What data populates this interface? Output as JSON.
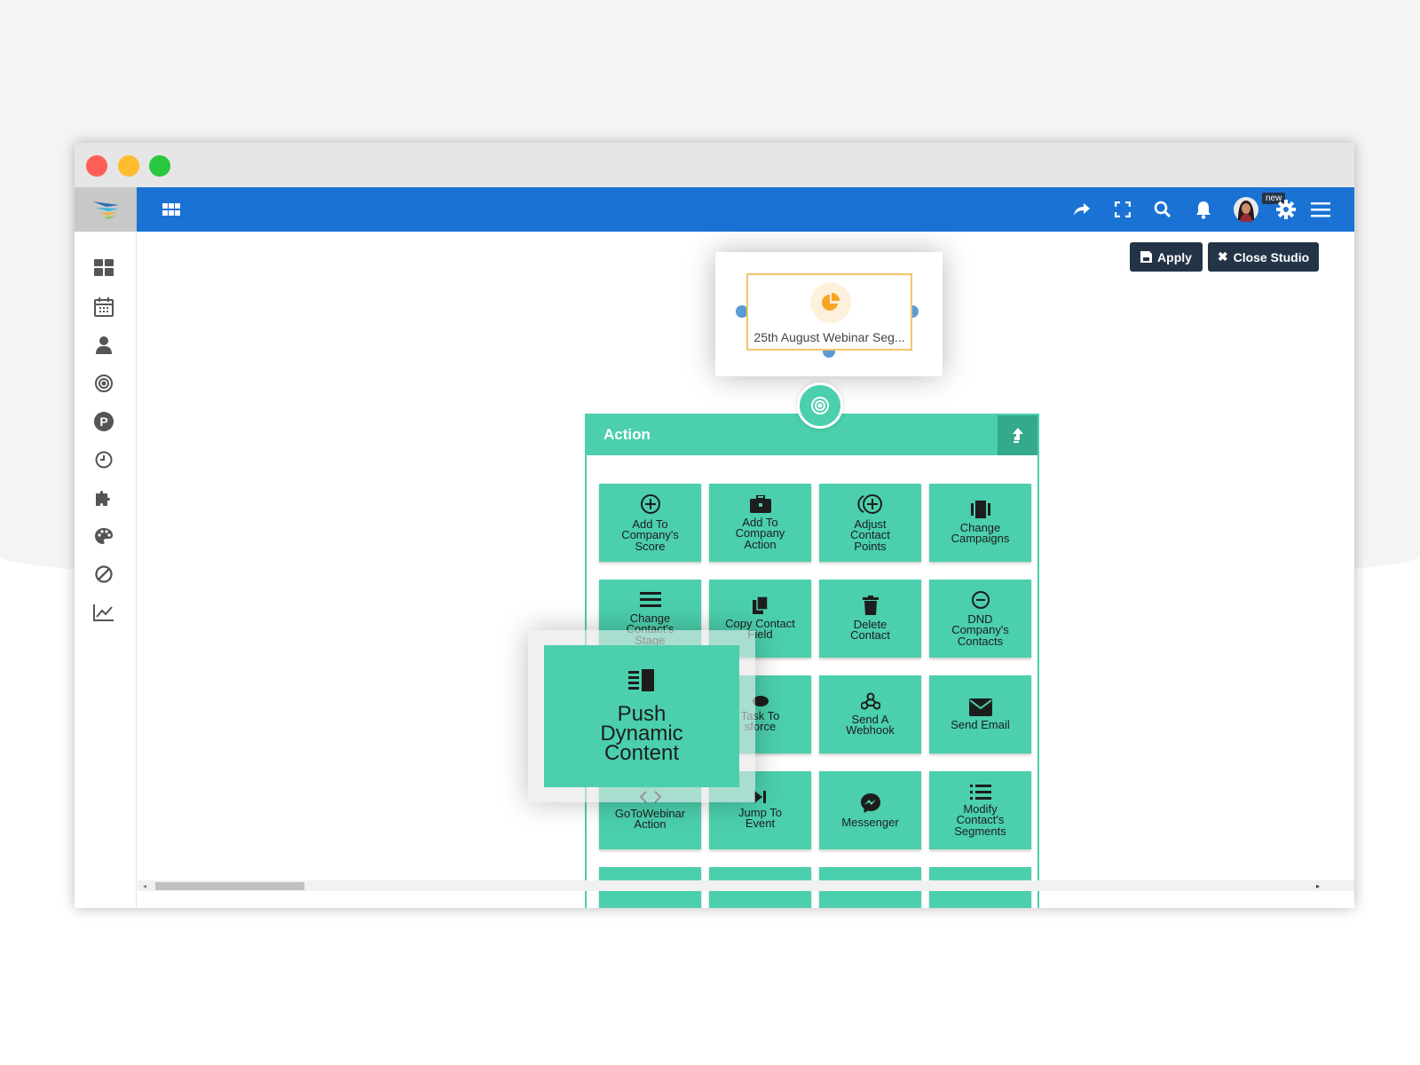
{
  "toolbar": {
    "apply_label": "Apply",
    "close_studio_label": "Close Studio",
    "notification_badge": "new"
  },
  "node": {
    "label": "25th August Webinar Seg..."
  },
  "action_panel": {
    "title": "Action",
    "tiles": [
      {
        "label": "Add To\nCompany's\nScore",
        "icon": "plus-circle-icon"
      },
      {
        "label": "Add To\nCompany\nAction",
        "icon": "briefcase-icon"
      },
      {
        "label": "Adjust\nContact\nPoints",
        "icon": "points-icon"
      },
      {
        "label": "Change\nCampaigns",
        "icon": "campaigns-icon"
      },
      {
        "label": "Change\nContact's\nStage",
        "icon": "stage-icon"
      },
      {
        "label": "Copy Contact\nField",
        "icon": "copy-icon"
      },
      {
        "label": "Delete\nContact",
        "icon": "trash-icon"
      },
      {
        "label": "DND\nCompany's\nContacts",
        "icon": "dnd-icon"
      },
      {
        "label": "",
        "icon": ""
      },
      {
        "label": "Task To\nsforce",
        "icon": "salesforce-icon"
      },
      {
        "label": "Send A\nWebhook",
        "icon": "webhook-icon"
      },
      {
        "label": "Send Email",
        "icon": "email-icon"
      },
      {
        "label": "GoToWebinar\nAction",
        "icon": "code-icon"
      },
      {
        "label": "Jump To\nEvent",
        "icon": "jump-icon"
      },
      {
        "label": "Messenger",
        "icon": "messenger-icon"
      },
      {
        "label": "Modify\nContact's\nSegments",
        "icon": "list-icon"
      },
      {
        "label": "",
        "icon": ""
      },
      {
        "label": "",
        "icon": ""
      },
      {
        "label": "",
        "icon": ""
      },
      {
        "label": "",
        "icon": ""
      }
    ]
  },
  "zoom_tile": {
    "label": "Push\nDynamic\nContent",
    "icon": "dynamic-content-icon"
  },
  "sidebar": {
    "items": [
      "dashboard-icon",
      "calendar-icon",
      "user-icon",
      "target-icon",
      "points-p-icon",
      "clock-icon",
      "puzzle-icon",
      "palette-icon",
      "block-icon",
      "chart-icon"
    ]
  },
  "colors": {
    "topbar": "#1a73d4",
    "accent": "#4bcfad",
    "dark_button": "#243447"
  }
}
